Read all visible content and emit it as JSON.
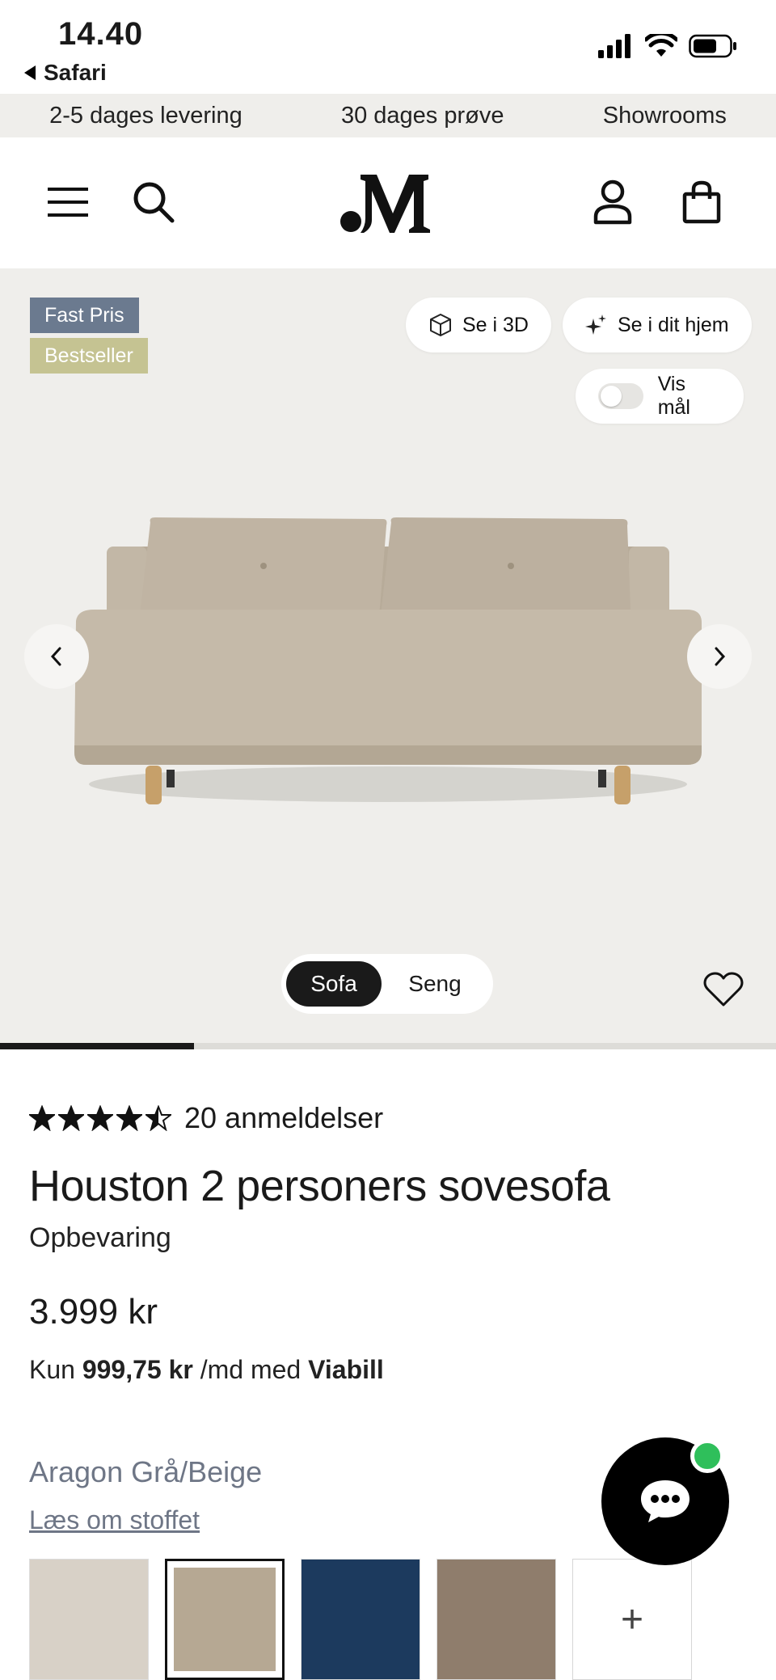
{
  "status_bar": {
    "time": "14.40",
    "back_app": "Safari"
  },
  "usp": [
    "2-5 dages levering",
    "30 dages prøve",
    "Showrooms"
  ],
  "header": {
    "icons": [
      "menu-icon",
      "search-icon",
      "brand-logo",
      "account-icon",
      "bag-icon"
    ]
  },
  "hero": {
    "badges": [
      "Fast Pris",
      "Bestseller"
    ],
    "see_3d": "Se i 3D",
    "see_home": "Se i dit hjem",
    "show_dims": "Vis mål",
    "segment": {
      "active": "Sofa",
      "inactive": "Seng"
    },
    "gallery_progress": 0.25
  },
  "product": {
    "rating": 4.5,
    "reviews": "20 anmeldelser",
    "title": "Houston 2 personers sovesofa",
    "subtitle": "Opbevaring",
    "price": "3.999 kr",
    "finance_prefix": "Kun",
    "finance_amount": "999,75 kr",
    "finance_mid": "/md med",
    "finance_provider": "Viabill",
    "fabric_name": "Aragon Grå/Beige",
    "fabric_link": "Læs om stoffet",
    "plus_label": "+"
  },
  "colors": {
    "badge_fast": "#6b7a8f",
    "badge_best": "#c5c392",
    "swatch_1": "#d8d1c7",
    "swatch_2": "#b6a893",
    "swatch_3": "#1c3a5e",
    "swatch_4": "#8f7d6c",
    "chat_online": "#2fbf5b"
  }
}
